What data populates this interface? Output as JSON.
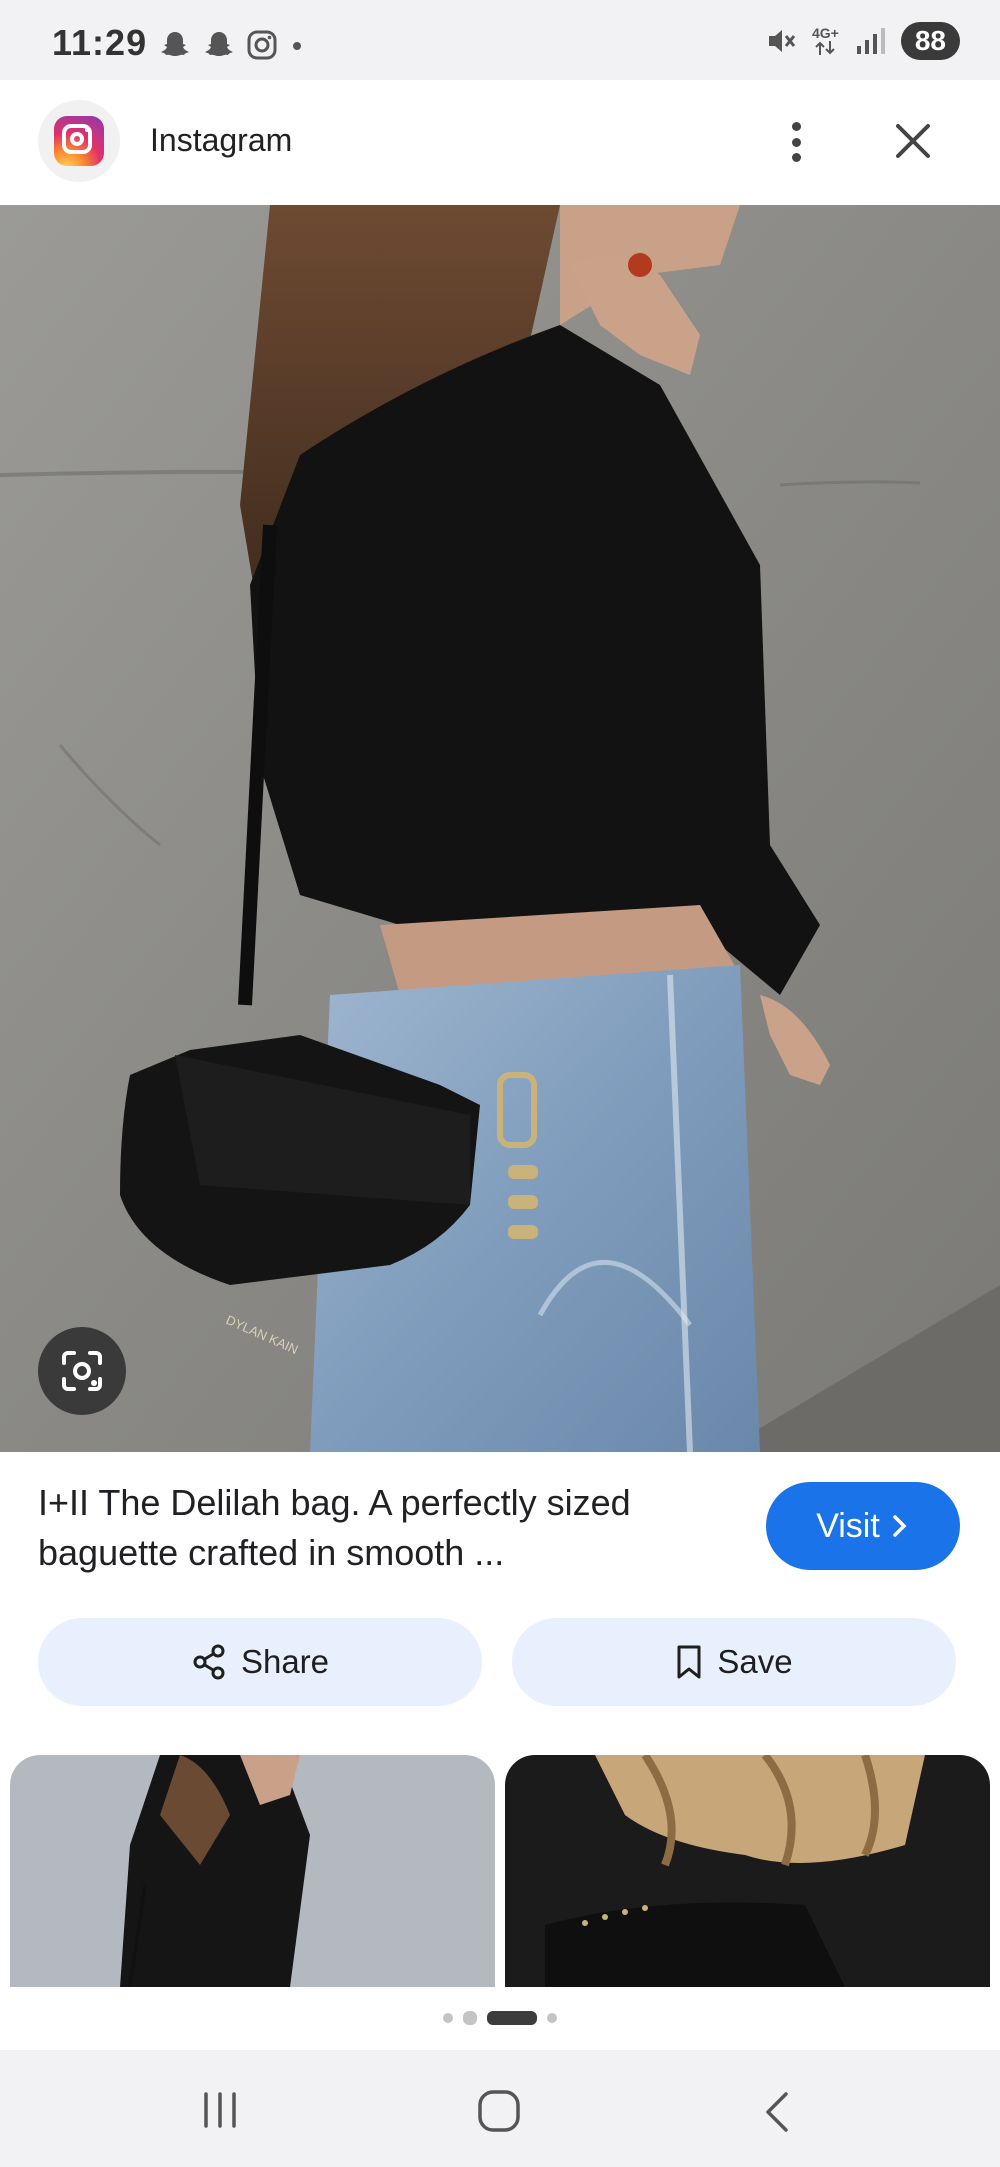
{
  "status_bar": {
    "time": "11:29",
    "network": "4G+",
    "battery": "88",
    "left_icons": [
      "snapchat-icon",
      "snapchat-icon",
      "instagram-icon",
      "notification-dot"
    ],
    "right_icons": [
      "mute-icon",
      "data-arrows-icon",
      "signal-icon",
      "battery-icon"
    ]
  },
  "header": {
    "app_name": "Instagram",
    "icons": [
      "instagram-logo",
      "more-vert-icon",
      "close-icon"
    ]
  },
  "hero": {
    "logo_text": "DYLAN KAIN",
    "lens_icon": "google-lens-icon"
  },
  "description": {
    "text": "I+II The Delilah bag. A perfectly sized baguette crafted in smooth ..."
  },
  "buttons": {
    "visit": "Visit",
    "share": "Share",
    "save": "Save"
  },
  "colors": {
    "visit_bg": "#1a73e8",
    "chip_bg": "#e8f0fe",
    "bars_bg": "#f2f2f4"
  },
  "pagination": {
    "total": 4,
    "active_index": 2
  }
}
